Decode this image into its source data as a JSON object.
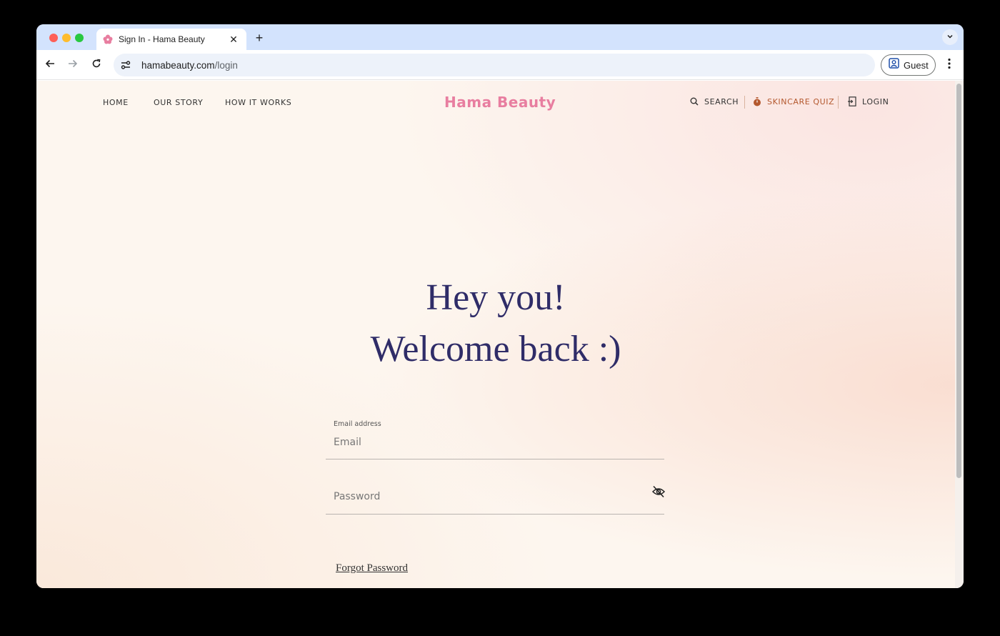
{
  "browser": {
    "tab_title": "Sign In - Hama Beauty",
    "tab_close": "✕",
    "new_tab": "+",
    "url_host": "hamabeauty.com",
    "url_path": "/login",
    "profile_label": "Guest"
  },
  "nav": {
    "left": [
      "HOME",
      "OUR STORY",
      "HOW IT WORKS"
    ],
    "brand": "Hama Beauty",
    "search_label": "SEARCH",
    "quiz_label": "SKINCARE QUIZ",
    "login_label": "LOGIN"
  },
  "login": {
    "heading_line1": "Hey you!",
    "heading_line2": "Welcome back :)",
    "email_label": "Email address",
    "email_placeholder": "Email",
    "password_placeholder": "Password",
    "forgot_password": "Forgot Password"
  },
  "colors": {
    "brand": "#e87ea0",
    "quiz": "#b4582e",
    "heading": "#2f2c68",
    "tabstrip": "#d3e3fd"
  }
}
